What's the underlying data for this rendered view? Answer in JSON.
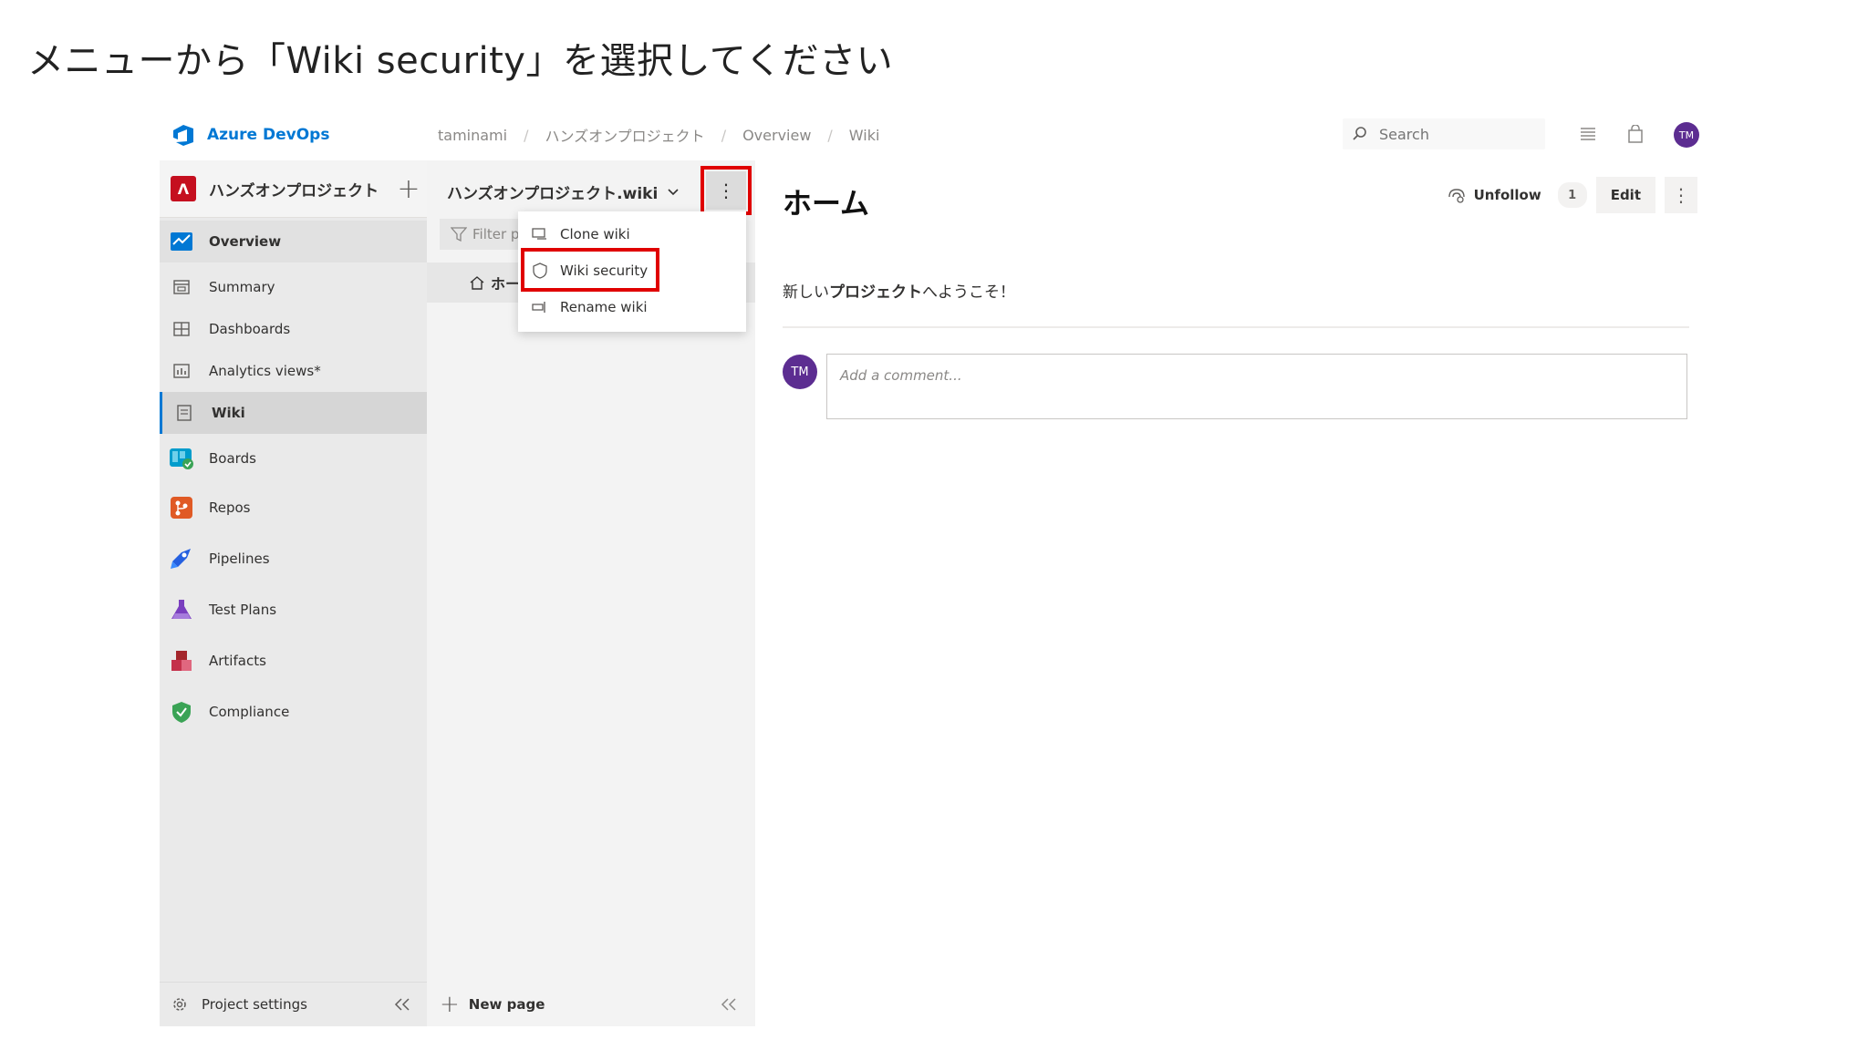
{
  "instruction": "メニューから「Wiki security」を選択してください",
  "topbar": {
    "brand": "Azure DevOps",
    "breadcrumb": [
      "taminami",
      "ハンズオンプロジェクト",
      "Overview",
      "Wiki"
    ],
    "search_placeholder": "Search",
    "avatar_initials": "TM"
  },
  "project": {
    "initial": "Λ",
    "name": "ハンズオンプロジェクト"
  },
  "nav": {
    "items": [
      {
        "label": "Overview",
        "icon": "overview-icon"
      },
      {
        "label": "Summary",
        "icon": "summary-icon"
      },
      {
        "label": "Dashboards",
        "icon": "dashboards-icon"
      },
      {
        "label": "Analytics views*",
        "icon": "analytics-icon"
      },
      {
        "label": "Wiki",
        "icon": "wiki-icon"
      },
      {
        "label": "Boards",
        "icon": "boards-icon"
      },
      {
        "label": "Repos",
        "icon": "repos-icon"
      },
      {
        "label": "Pipelines",
        "icon": "pipelines-icon"
      },
      {
        "label": "Test Plans",
        "icon": "test-plans-icon"
      },
      {
        "label": "Artifacts",
        "icon": "artifacts-icon"
      },
      {
        "label": "Compliance",
        "icon": "compliance-icon"
      }
    ],
    "project_settings": "Project settings"
  },
  "tree": {
    "wiki_name": "ハンズオンプロジェクト.wiki",
    "filter": "Filter p",
    "home_item": "ホー",
    "new_page": "New page"
  },
  "menu": {
    "items": [
      {
        "label": "Clone wiki",
        "icon": "clone-icon"
      },
      {
        "label": "Wiki security",
        "icon": "shield-icon"
      },
      {
        "label": "Rename wiki",
        "icon": "rename-icon"
      }
    ]
  },
  "main": {
    "title": "ホーム",
    "unfollow": "Unfollow",
    "follow_count": "1",
    "edit": "Edit",
    "welcome_prefix": "新しい",
    "welcome_bold": "プロジェクト",
    "welcome_suffix": "へようこそ！",
    "comment_placeholder": "Add a comment...",
    "comment_avatar": "TM"
  },
  "colors": {
    "accent": "#0078d4",
    "highlight": "#e00000",
    "avatar": "#5c2d91",
    "project_badge": "#c50f1f"
  }
}
